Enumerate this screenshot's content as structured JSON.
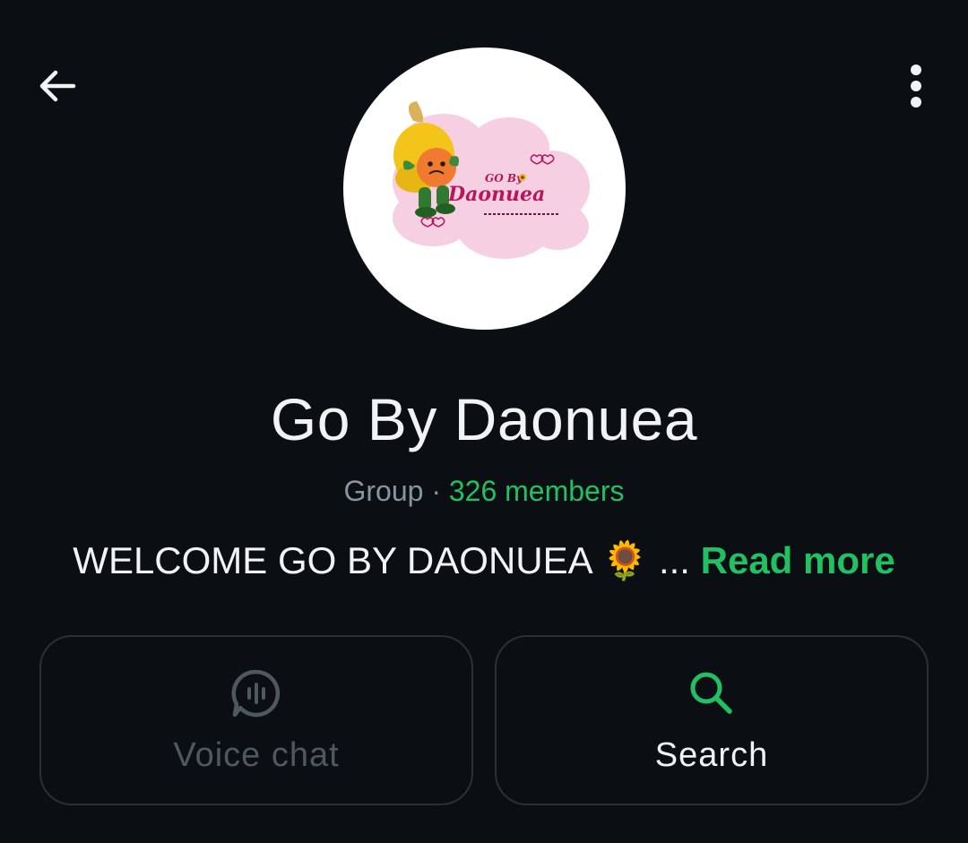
{
  "header": {
    "back_icon": "arrow-left-icon",
    "menu_icon": "more-vertical-icon"
  },
  "group": {
    "avatar_icon": "group-logo",
    "name": "Go By Daonuea",
    "type_label": "Group",
    "separator": "·",
    "members": "326 members",
    "description": "WELCOME GO BY DAONUEA 🌻 ...",
    "read_more": "Read more"
  },
  "actions": {
    "voice_chat": {
      "label": "Voice chat",
      "icon": "voice-chat-icon",
      "enabled": false
    },
    "search": {
      "label": "Search",
      "icon": "search-icon",
      "enabled": true
    }
  },
  "colors": {
    "background": "#0b0f14",
    "accent": "#21c063",
    "muted": "#8696a0",
    "disabled": "#4e585f",
    "card_border": "#2a3036"
  }
}
